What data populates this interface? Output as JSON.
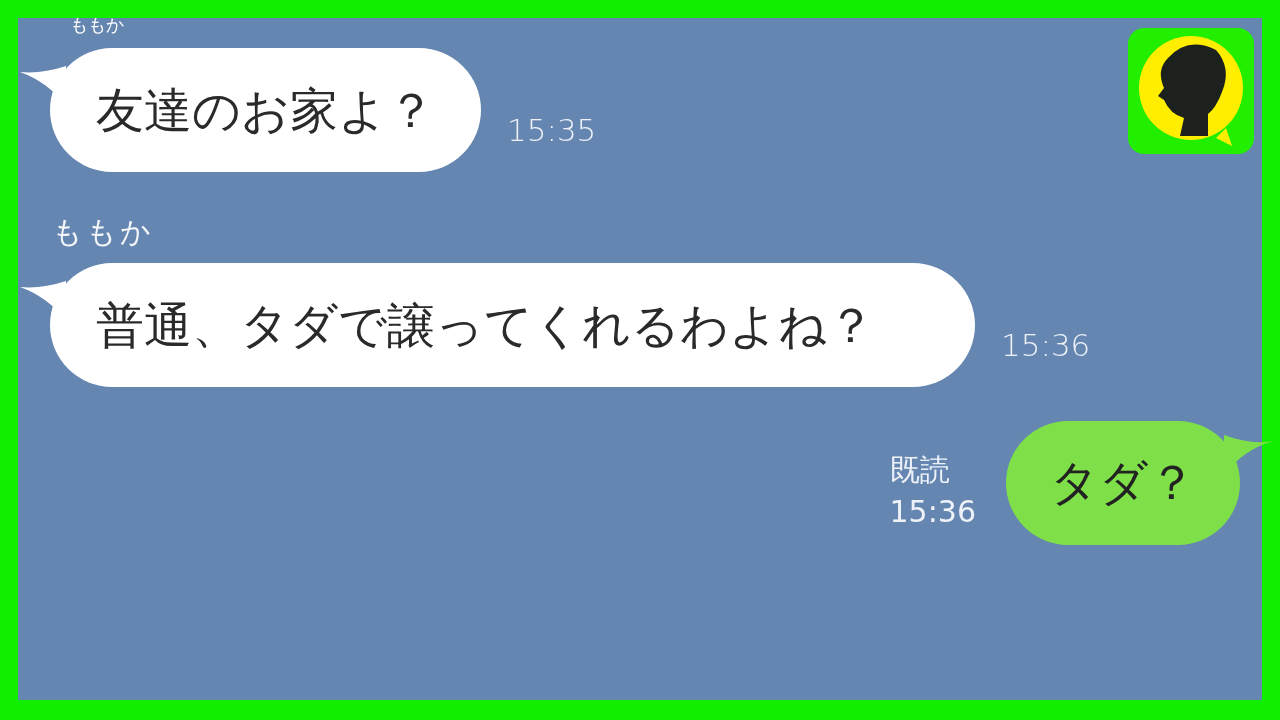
{
  "messages": [
    {
      "kind": "incoming",
      "sender": "ももか",
      "text": "友達のお家よ？",
      "time": "15:35"
    },
    {
      "kind": "incoming",
      "sender": "ももか",
      "text": "普通、タダで譲ってくれるわよね？",
      "time": "15:36"
    },
    {
      "kind": "outgoing",
      "read": "既読",
      "text": "タダ？",
      "time": "15:36"
    }
  ]
}
